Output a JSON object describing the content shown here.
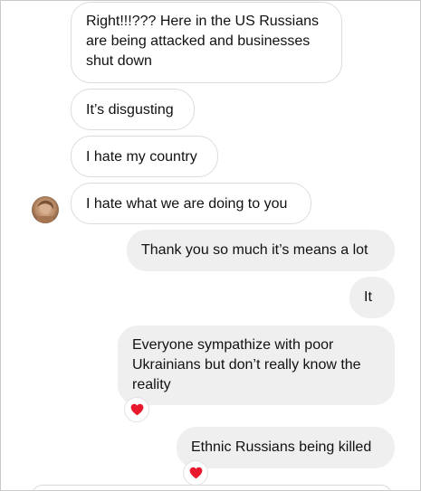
{
  "conversation": {
    "messages": [
      {
        "sender": "other",
        "text": "Right!!!??? Here in the US Russians are being attacked and businesses shut down"
      },
      {
        "sender": "other",
        "text": "It’s disgusting"
      },
      {
        "sender": "other",
        "text": "I hate my country"
      },
      {
        "sender": "other",
        "text": "I hate what we are doing to you"
      },
      {
        "sender": "me",
        "text": "Thank you so much it’s means a lot"
      },
      {
        "sender": "me",
        "text": "It"
      },
      {
        "sender": "me",
        "text": "Everyone sympathize with poor Ukrainians but don’t really know the reality",
        "reaction": "heart-icon"
      },
      {
        "sender": "me",
        "text": "Ethnic Russians being killed",
        "reaction": "heart-icon"
      }
    ]
  },
  "colors": {
    "incoming_bubble": "#ffffff",
    "incoming_border": "#dcdcdc",
    "outgoing_bubble": "#efefef",
    "heart": "#e8192c"
  }
}
